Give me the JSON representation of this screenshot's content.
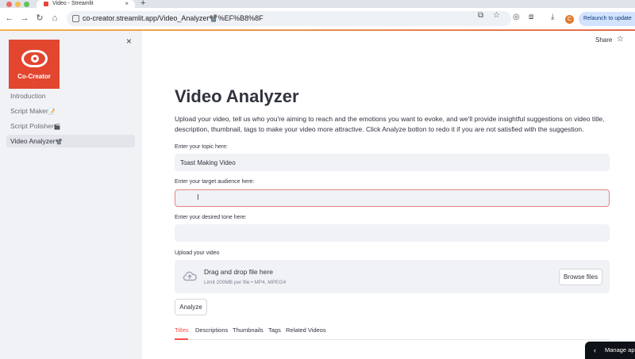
{
  "browser": {
    "tab_title": "Video - Streamlit",
    "tab_close": "×",
    "new_tab": "+",
    "url": "co-creator.streamlit.app/Video_Analyzer📽️%EF%B8%8F",
    "relaunch_label": "Relaunch to update",
    "profile_initial": "C"
  },
  "sidebar": {
    "logo_text": "Co-Creator",
    "items": [
      {
        "label": "Introduction",
        "emoji": ""
      },
      {
        "label": "Script Maker",
        "emoji": "📝"
      },
      {
        "label": "Script Polisher",
        "emoji": "🎬"
      },
      {
        "label": "Video Analyzer",
        "emoji": "📽️"
      }
    ],
    "close_glyph": "×"
  },
  "header": {
    "share_label": "Share"
  },
  "main": {
    "title": "Video Analyzer",
    "description": "Upload your video, tell us who you're aiming to reach and the emotions you want to evoke, and we'll provide insightful suggestions on video title, description, thumbnail, tags to make your video more attractive. Click Analyze botton to redo it if you are not satisfied with the suggestion.",
    "topic_label": "Enter your topic here:",
    "topic_value": "Toast Making Video",
    "audience_label": "Enter your target audience here:",
    "audience_value": "",
    "tone_label": "Enter your desired tone here:",
    "tone_value": "",
    "upload_label": "Upload your video",
    "upload_title": "Drag and drop file here",
    "upload_sub": "Limit 200MB per file • MP4, MPEG4",
    "browse_label": "Browse files",
    "analyze_label": "Analyze",
    "tabs": [
      "Titles",
      "Descriptions",
      "Thumbnails",
      "Tags",
      "Related Videos"
    ],
    "active_tab": "Titles"
  },
  "footer": {
    "manage_label": "Manage app"
  },
  "colors": {
    "accent": "#ff4b4b",
    "sidebar_bg": "#f0f2f6",
    "logo_bg": "#e2462f"
  }
}
